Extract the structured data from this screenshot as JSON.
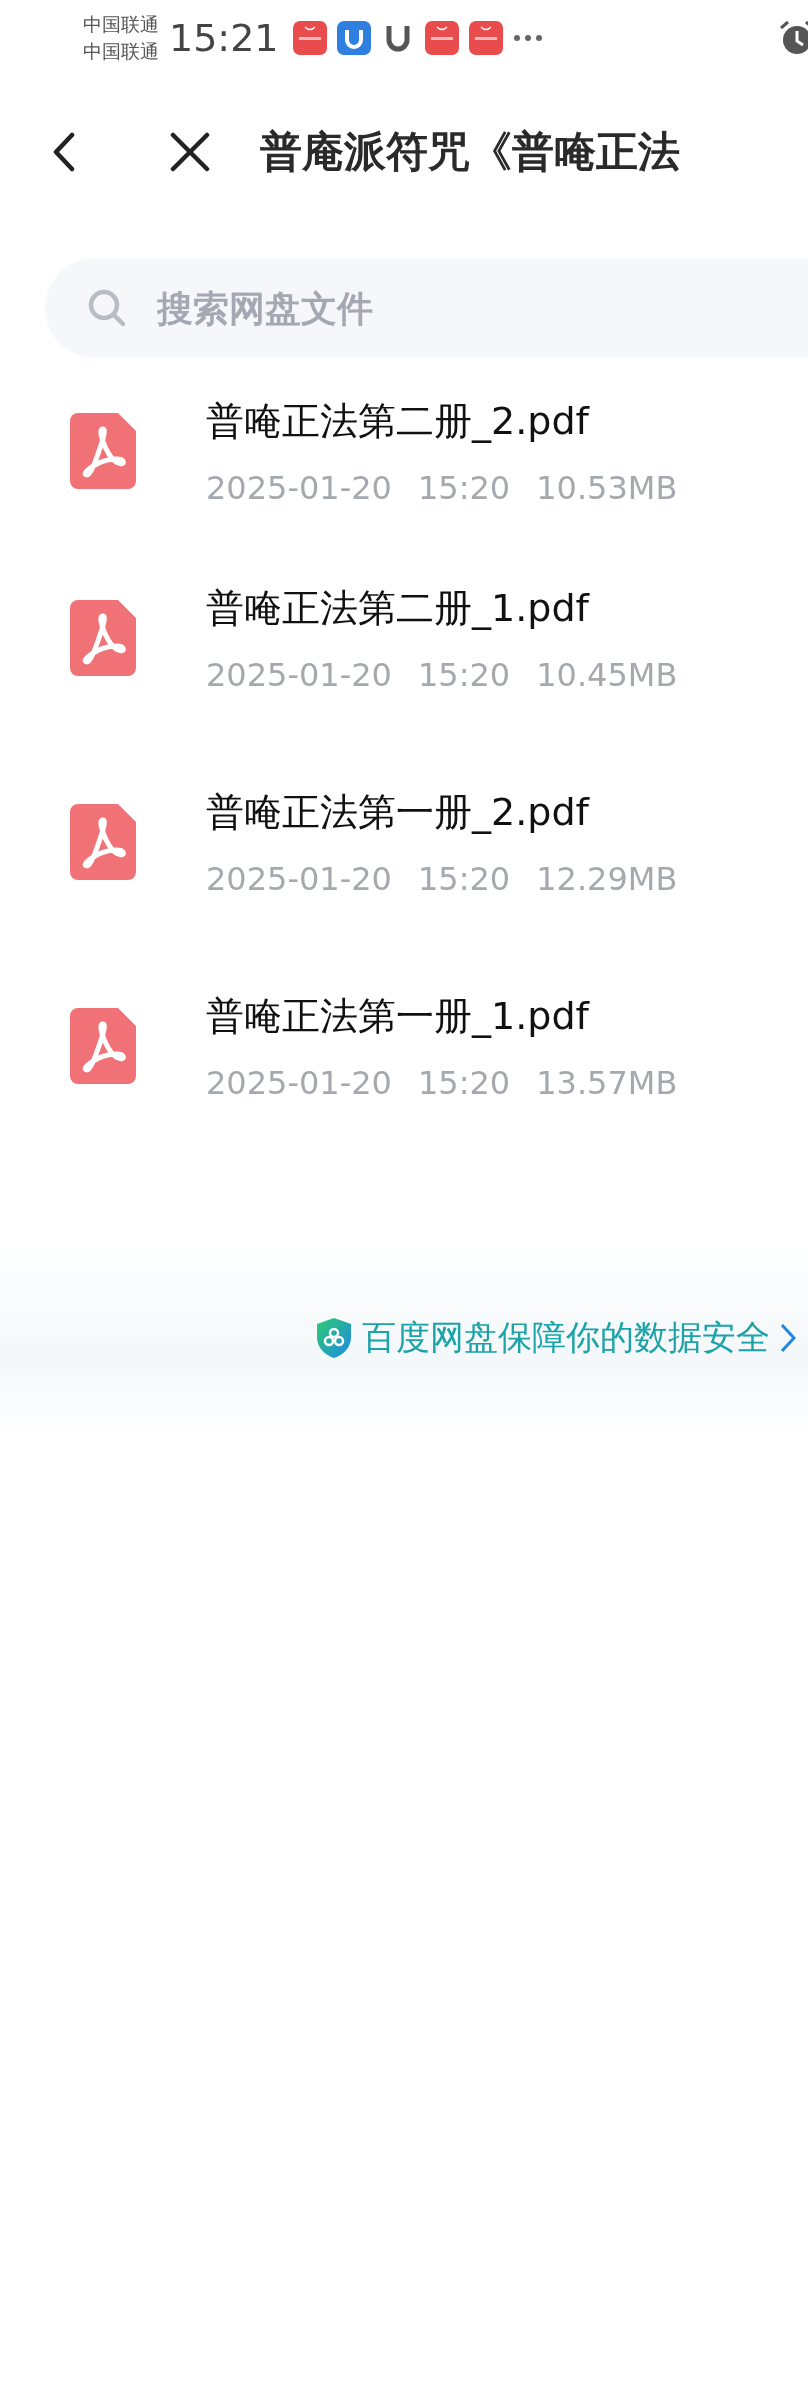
{
  "status_bar": {
    "carriers": [
      "中国联通",
      "中国联通"
    ],
    "time": "15:21"
  },
  "header": {
    "title": "普庵派符咒《普唵正法"
  },
  "search": {
    "placeholder": "搜索网盘文件"
  },
  "files": [
    {
      "name": "普唵正法第二册_2.pdf",
      "date": "2025-01-20",
      "time": "15:20",
      "size": "10.53MB"
    },
    {
      "name": "普唵正法第二册_1.pdf",
      "date": "2025-01-20",
      "time": "15:20",
      "size": "10.45MB"
    },
    {
      "name": "普唵正法第一册_2.pdf",
      "date": "2025-01-20",
      "time": "15:20",
      "size": "12.29MB"
    },
    {
      "name": "普唵正法第一册_1.pdf",
      "date": "2025-01-20",
      "time": "15:20",
      "size": "13.57MB"
    }
  ],
  "footer": {
    "text": "百度网盘保障你的数据安全"
  }
}
